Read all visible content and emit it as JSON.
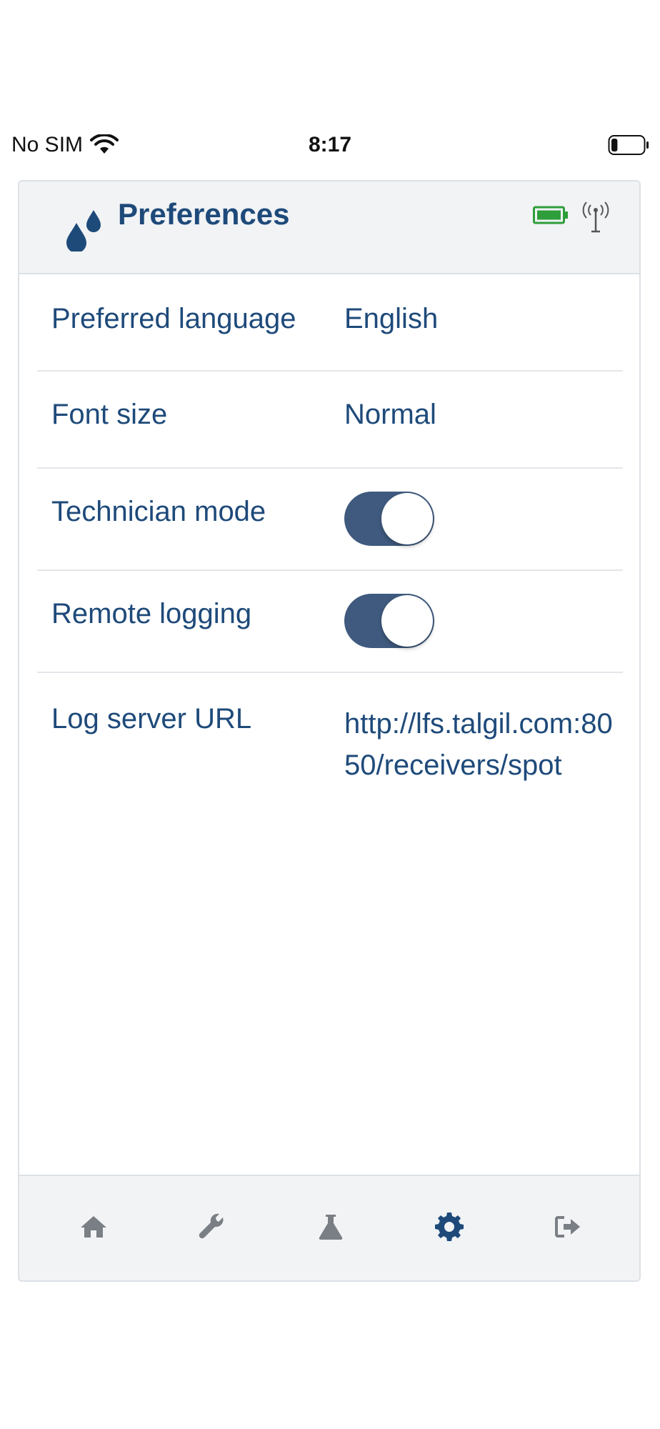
{
  "status_bar": {
    "carrier": "No SIM",
    "time": "8:17",
    "battery_level": 0.2
  },
  "header": {
    "title": "Preferences",
    "icons": [
      "drops-icon",
      "battery-icon",
      "antenna-icon"
    ]
  },
  "settings": {
    "language_label": "Preferred language",
    "language_value": "English",
    "font_label": "Font size",
    "font_value": "Normal",
    "technician_label": "Technician mode",
    "technician_on": true,
    "remote_logging_label": "Remote logging",
    "remote_logging_on": true,
    "log_url_label": "Log server URL",
    "log_url_value": "http://lfs.talgil.com:8050/receivers/spot"
  },
  "tabs": [
    {
      "name": "home-icon",
      "active": false
    },
    {
      "name": "wrench-icon",
      "active": false
    },
    {
      "name": "flask-icon",
      "active": false
    },
    {
      "name": "gear-icon",
      "active": true
    },
    {
      "name": "logout-icon",
      "active": false
    }
  ],
  "colors": {
    "primary": "#1e4a7a",
    "toggle_on": "#3f5a7e",
    "tab_inactive": "#7a7f85",
    "header_bg": "#f1f3f5",
    "battery_green": "#2e9e3a"
  }
}
